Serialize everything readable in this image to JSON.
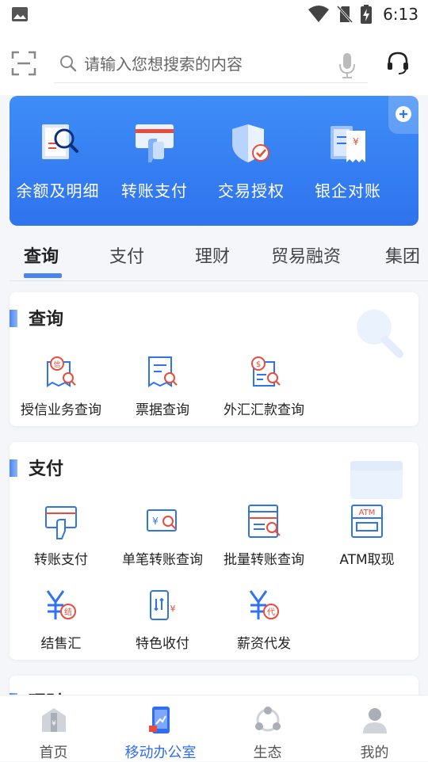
{
  "status_bar": {
    "time": "6:13"
  },
  "search": {
    "placeholder": "请输入您想搜索的内容"
  },
  "banner": {
    "items": [
      {
        "label": "余额及明细",
        "icon": "balance-search-icon"
      },
      {
        "label": "转账支付",
        "icon": "transfer-pay-icon"
      },
      {
        "label": "交易授权",
        "icon": "shield-check-icon"
      },
      {
        "label": "银企对账",
        "icon": "bill-yuan-icon"
      }
    ]
  },
  "tabs": [
    "查询",
    "支付",
    "理财",
    "贸易融资",
    "集团"
  ],
  "sections": {
    "query": {
      "title": "查询",
      "items": [
        {
          "label": "授信业务查询",
          "icon": "credit-query-icon"
        },
        {
          "label": "票据查询",
          "icon": "bill-query-icon"
        },
        {
          "label": "外汇汇款查询",
          "icon": "fx-remit-query-icon"
        }
      ]
    },
    "payment": {
      "title": "支付",
      "items": [
        {
          "label": "转账支付",
          "icon": "transfer-icon"
        },
        {
          "label": "单笔转账查询",
          "icon": "single-transfer-query-icon"
        },
        {
          "label": "批量转账查询",
          "icon": "batch-transfer-query-icon"
        },
        {
          "label": "ATM取现",
          "icon": "atm-icon"
        },
        {
          "label": "结售汇",
          "icon": "fx-settle-icon"
        },
        {
          "label": "特色收付",
          "icon": "special-pay-icon"
        },
        {
          "label": "薪资代发",
          "icon": "salary-icon"
        }
      ]
    },
    "wealth": {
      "title": "理财"
    }
  },
  "bottom_nav": [
    {
      "label": "首页",
      "icon": "home-icon"
    },
    {
      "label": "移动办公室",
      "icon": "mobile-office-icon"
    },
    {
      "label": "生态",
      "icon": "ecology-icon"
    },
    {
      "label": "我的",
      "icon": "profile-icon"
    }
  ],
  "colors": {
    "primary": "#2f73ee",
    "accent_red": "#e74c3c",
    "background": "#f4f6f9"
  }
}
